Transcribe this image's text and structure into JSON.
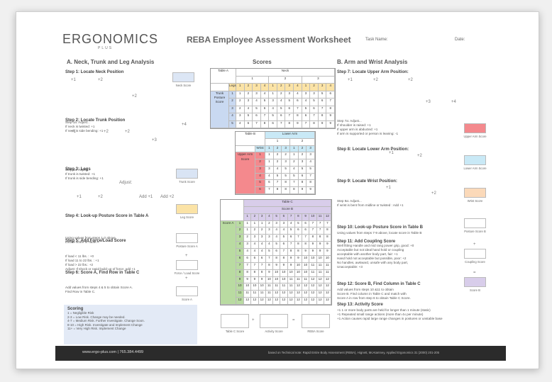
{
  "header": {
    "logo": "ERGONOMICS",
    "logo_sub": "PLUS",
    "title": "REBA Employee Assessment Worksheet",
    "task_name": "Task Name:",
    "date": "Date:"
  },
  "section_a": {
    "title": "A.  Neck, Trunk and Leg Analysis"
  },
  "section_b": {
    "title": "B. Arm and Wrist Analysis"
  },
  "scores_title": "Scores",
  "steps_a": [
    {
      "title": "Step 1: Locate Neck Position",
      "note": "Step 1a: Adjust...\nIf neck is twisted: +1\nIf neck is side bending: +1",
      "score_label": "Neck Score"
    },
    {
      "title": "Step 2: Locate Trunk Position",
      "note": "Step 2a: Adjust...\nIf trunk is twisted: +1\nIf trunk is side bending: +1",
      "score_label": "Trunk Score"
    },
    {
      "title": "Step 3: Legs",
      "note": "",
      "score_label": "Leg Score"
    },
    {
      "title": "Step 4: Look-up Posture Score in Table A",
      "note": "Using values from steps 1-3 above,\nLocate score in Table A",
      "score_label": "Posture Score A"
    },
    {
      "title": "Step 5: Add Force/Load Score",
      "note": "If load < 11 lbs. : +0\nIf load 11 to 22 lbs. : +1\nIf load > 22 lbs.: +2\nAdjust: If shock or rapid build up of force: add +1",
      "score_label": "Force / Load Score"
    },
    {
      "title": "Step 6: Score A, Find Row in Table C",
      "note": "Add values from steps 4 & 5 to obtain Score A.\nFind Row in Table C.",
      "score_label": "Score A"
    }
  ],
  "steps_b": [
    {
      "title": "Step 7: Locate Upper Arm Position:",
      "note": "Step 7a: Adjust...\nIf shoulder is raised: +1\nIf upper arm is abducted: +1\nIf arm is supported or person is leaning: -1",
      "score_label": "Upper Arm Score"
    },
    {
      "title": "Step 8: Locate Lower Arm Position:",
      "note": "",
      "score_label": "Lower Arm Score"
    },
    {
      "title": "Step 9: Locate Wrist Position:",
      "note": "Step 9a: Adjust...\nIf wrist is bent from midline or twisted : Add +1",
      "score_label": "Wrist Score"
    },
    {
      "title": "Step 10: Look-up Posture Score in Table B",
      "note": "Using values from steps 7-9 above, locate score in Table B",
      "score_label": "Posture Score B"
    },
    {
      "title": "Step 11: Add Coupling Score",
      "note": "Well fitting Handle and mid rang power grip, good: +0\nAcceptable but not ideal hand hold or coupling\nacceptable with another body part, fair: +1\nHand hold not acceptable but possible, poor: +2\nNo handles, awkward, unsafe with any body part,\nUnacceptable: +3",
      "score_label": "Coupling Score"
    },
    {
      "title": "Step 12: Score B, Find Column in Table C",
      "note": "Add values from steps 10 &11 to obtain\nScore B. Find column in Table C and match with\nScore A in row from step 6 to obtain Table C Score.",
      "score_label": "Score B"
    },
    {
      "title": "Step 13: Activity Score",
      "note": "+1 1 or more body parts are held for longer than 1 minute (static)\n+1 Repeated small range actions (more than 4x per minute)\n+1 Action causes rapid large range changes in postures or unstable base",
      "score_label": ""
    }
  ],
  "figure_marks": {
    "neck": [
      "+1",
      "+2",
      "+2"
    ],
    "trunk": [
      "+1",
      "+2",
      "+2",
      "+3",
      "+4"
    ],
    "legs": [
      "Adjust:",
      "+1",
      "+2",
      "Add +1",
      "Add +2"
    ],
    "upper_arm": [
      "+1",
      "+2",
      "+2",
      "+3",
      "+4"
    ],
    "lower_arm": [
      "+1",
      "+2"
    ],
    "wrist": [
      "+1",
      "+2"
    ]
  },
  "ops": {
    "plus": "+",
    "equals": "="
  },
  "table_a": {
    "label": "Table A",
    "neck": "Neck",
    "legs": "Legs",
    "neck_cols": [
      "1",
      "2",
      "3"
    ],
    "leg_cols": [
      "1",
      "2",
      "3",
      "4",
      "1",
      "2",
      "3",
      "4",
      "1",
      "2",
      "3",
      "4"
    ],
    "row_label": "Trunk Posture Score",
    "rows": [
      [
        "1",
        "1",
        "2",
        "3",
        "4",
        "1",
        "2",
        "3",
        "4",
        "3",
        "3",
        "5",
        "6"
      ],
      [
        "2",
        "2",
        "3",
        "4",
        "5",
        "3",
        "4",
        "5",
        "6",
        "4",
        "5",
        "6",
        "7"
      ],
      [
        "3",
        "2",
        "4",
        "5",
        "6",
        "4",
        "5",
        "6",
        "7",
        "5",
        "6",
        "7",
        "8"
      ],
      [
        "4",
        "3",
        "5",
        "6",
        "7",
        "5",
        "6",
        "7",
        "8",
        "6",
        "7",
        "8",
        "9"
      ],
      [
        "5",
        "4",
        "6",
        "7",
        "8",
        "6",
        "7",
        "8",
        "9",
        "7",
        "8",
        "9",
        "9"
      ]
    ]
  },
  "table_b": {
    "label": "Table B",
    "lower_arm": "Lower Arm",
    "wrist": "Wrist",
    "la_cols": [
      "1",
      "2"
    ],
    "wrist_cols": [
      "1",
      "2",
      "3",
      "1",
      "2",
      "3"
    ],
    "row_label": "Upper Arm Score",
    "rows": [
      [
        "1",
        "1",
        "2",
        "2",
        "1",
        "2",
        "3"
      ],
      [
        "2",
        "1",
        "2",
        "3",
        "2",
        "3",
        "4"
      ],
      [
        "3",
        "3",
        "4",
        "5",
        "4",
        "5",
        "5"
      ],
      [
        "4",
        "4",
        "5",
        "5",
        "5",
        "6",
        "7"
      ],
      [
        "5",
        "6",
        "7",
        "8",
        "7",
        "8",
        "8"
      ],
      [
        "6",
        "7",
        "8",
        "8",
        "8",
        "9",
        "9"
      ]
    ]
  },
  "table_c": {
    "label": "Table C",
    "score_b": "Score B",
    "score_a": "Score A",
    "cols": [
      "1",
      "2",
      "3",
      "4",
      "5",
      "6",
      "7",
      "8",
      "9",
      "10",
      "11",
      "12"
    ],
    "rows": [
      [
        "1",
        "1",
        "1",
        "1",
        "2",
        "3",
        "3",
        "4",
        "5",
        "6",
        "7",
        "7",
        "7"
      ],
      [
        "2",
        "1",
        "2",
        "2",
        "3",
        "4",
        "4",
        "5",
        "6",
        "6",
        "7",
        "7",
        "8"
      ],
      [
        "3",
        "2",
        "3",
        "3",
        "3",
        "4",
        "5",
        "6",
        "7",
        "7",
        "8",
        "8",
        "8"
      ],
      [
        "4",
        "3",
        "4",
        "4",
        "4",
        "5",
        "6",
        "7",
        "8",
        "8",
        "9",
        "9",
        "9"
      ],
      [
        "5",
        "4",
        "4",
        "4",
        "5",
        "6",
        "7",
        "8",
        "8",
        "9",
        "9",
        "9",
        "9"
      ],
      [
        "6",
        "6",
        "6",
        "6",
        "7",
        "8",
        "8",
        "9",
        "9",
        "10",
        "10",
        "10",
        "10"
      ],
      [
        "7",
        "7",
        "7",
        "7",
        "8",
        "9",
        "9",
        "9",
        "10",
        "10",
        "11",
        "11",
        "11"
      ],
      [
        "8",
        "8",
        "8",
        "8",
        "9",
        "10",
        "10",
        "10",
        "10",
        "10",
        "11",
        "11",
        "11"
      ],
      [
        "9",
        "9",
        "9",
        "9",
        "10",
        "10",
        "10",
        "11",
        "11",
        "11",
        "12",
        "12",
        "12"
      ],
      [
        "10",
        "10",
        "10",
        "10",
        "11",
        "11",
        "11",
        "11",
        "12",
        "12",
        "12",
        "12",
        "12"
      ],
      [
        "11",
        "11",
        "11",
        "11",
        "11",
        "12",
        "12",
        "12",
        "12",
        "12",
        "12",
        "12",
        "12"
      ],
      [
        "12",
        "12",
        "12",
        "12",
        "12",
        "12",
        "12",
        "12",
        "12",
        "12",
        "12",
        "12",
        "12"
      ]
    ]
  },
  "bottom_labels": {
    "table_c_score": "Table C Score",
    "activity_score": "Activity Score",
    "reba_score": "REBA Score"
  },
  "scoring": {
    "title": "Scoring",
    "lines": [
      "1 = Negligible Risk",
      "2-3 = Low Risk. Change may be needed.",
      "4-7 = Medium Risk. Further Investigate. Change Soon.",
      "8-10 = High Risk. Investigate and Implement Change",
      "11+ = Very High Risk. Implement Change"
    ]
  },
  "footer": {
    "left": "www.ergo-plus.com   |   765.384.4499",
    "right": "based on Technical note: Rapid Entire Body Assessment (REBA), Hignett, McAtamney, Applied Ergonomics 31 (2000) 201-205"
  },
  "colors": {
    "neck": "#dce6f5",
    "trunk": "#d9e4f4",
    "leg": "#fbe3a6",
    "upper_arm": "#f4898d",
    "lower_arm": "#c9e9f6",
    "wrist": "#fbd9b9",
    "score_b": "#d8cdea",
    "table_a_head": "#fbe3a6",
    "table_a_rows": "#c9d9f1",
    "table_b_head": "#c9e9f6",
    "table_b_rows": "#f4898d",
    "table_c_head": "#d8cdea",
    "table_c_rows": "#b9dba1"
  }
}
